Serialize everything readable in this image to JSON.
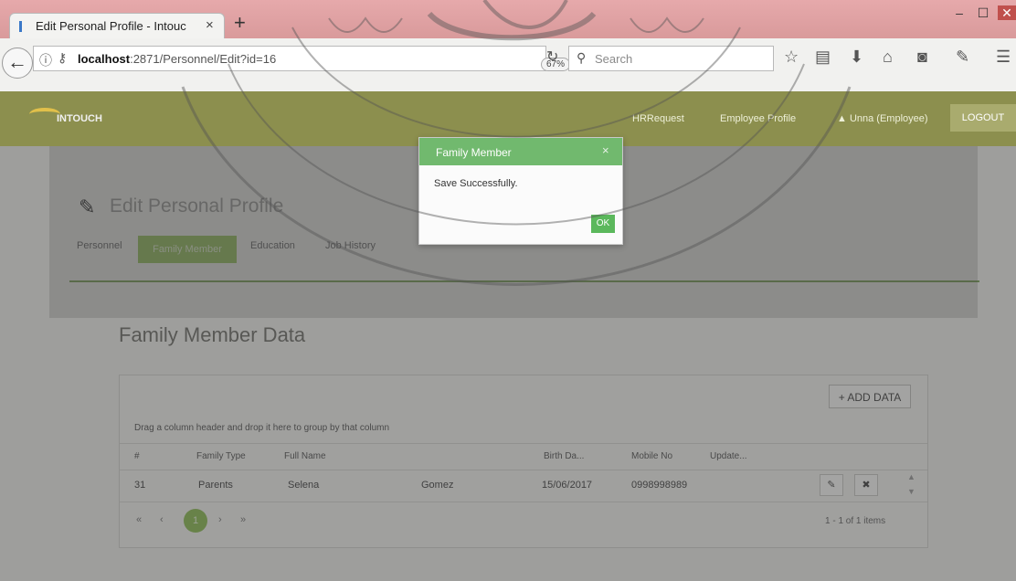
{
  "browser": {
    "tab_title": "Edit Personal Profile - Intouc",
    "tab_close": "×",
    "new_tab": "+",
    "url_host": "localhost",
    "url_path": ":2871/Personnel/Edit?id=16",
    "zoom": "67%",
    "search_placeholder": "Search"
  },
  "app": {
    "logo": "INTOUCH",
    "nav": [
      "HRRequest",
      "Employee Profile"
    ],
    "user": "▲ Unna (Employee)",
    "logout": "LOGOUT"
  },
  "page": {
    "title": "Edit Personal Profile",
    "tabs": [
      "Personnel",
      "Family Member",
      "Education",
      "Job History"
    ],
    "active_tab": "Family Member",
    "section_title": "Family Member Data",
    "add_button": "+ ADD DATA",
    "group_hint": "Drag a column header and drop it here to group by that column",
    "columns": [
      "#",
      "Family Type",
      "Full Name",
      "Birth Da...",
      "Mobile No",
      "Update..."
    ],
    "rows": [
      {
        "id": "31",
        "family_type": "Parents",
        "first_name": "Selena",
        "last_name": "Gomez",
        "birth_date": "15/06/2017",
        "mobile": "0998998989"
      }
    ],
    "pager": {
      "current": "1",
      "info": "1 - 1 of 1 items"
    }
  },
  "modal": {
    "title": "Family Member",
    "message": "Save Successfully.",
    "ok": "OK",
    "close": "×"
  },
  "colors": {
    "app_header": "#8c8f4e",
    "accent_green": "#71b96e",
    "tab_strip": "#d99a9b"
  }
}
